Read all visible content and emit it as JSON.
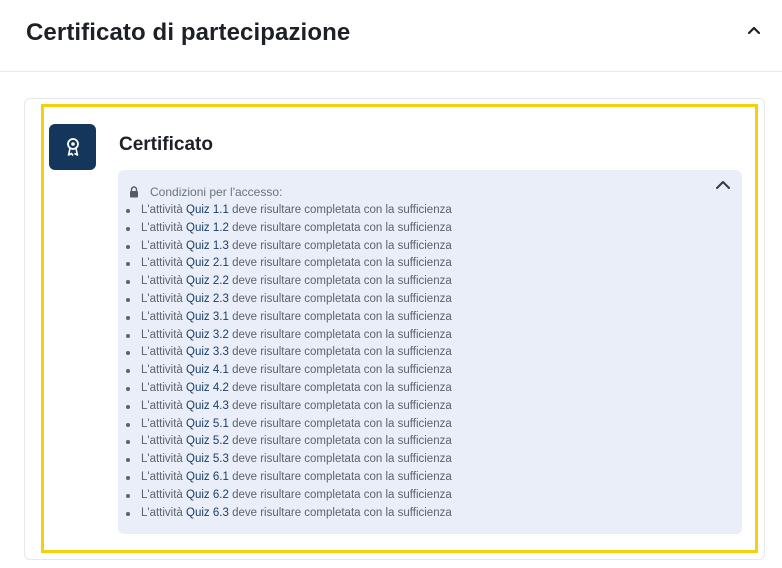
{
  "section": {
    "title": "Certificato di partecipazione"
  },
  "activity": {
    "name": "Certificato",
    "icon": "certificate-icon",
    "icon_bg": "#14365a",
    "highlight_color": "#f6d00b"
  },
  "restrictions": {
    "label": "Condizioni per l'accesso:",
    "bg": "#e9eef8",
    "items": [
      {
        "prefix": "L'attività",
        "quiz": "Quiz 1.1",
        "suffix": "deve risultare completata con la sufficienza"
      },
      {
        "prefix": "L'attività",
        "quiz": "Quiz 1.2",
        "suffix": "deve risultare completata con la sufficienza"
      },
      {
        "prefix": "L'attività",
        "quiz": "Quiz 1.3",
        "suffix": "deve risultare completata con la sufficienza"
      },
      {
        "prefix": "L'attività",
        "quiz": "Quiz 2.1",
        "suffix": "deve risultare completata con la sufficienza"
      },
      {
        "prefix": "L'attività",
        "quiz": "Quiz 2.2",
        "suffix": "deve risultare completata con la sufficienza"
      },
      {
        "prefix": "L'attività",
        "quiz": "Quiz 2.3",
        "suffix": "deve risultare completata con la sufficienza"
      },
      {
        "prefix": "L'attività",
        "quiz": "Quiz 3.1",
        "suffix": "deve risultare completata con la sufficienza"
      },
      {
        "prefix": "L'attività",
        "quiz": "Quiz 3.2",
        "suffix": "deve risultare completata con la sufficienza"
      },
      {
        "prefix": "L'attività",
        "quiz": "Quiz 3.3",
        "suffix": "deve risultare completata con la sufficienza"
      },
      {
        "prefix": "L'attività",
        "quiz": "Quiz 4.1",
        "suffix": "deve risultare completata con la sufficienza"
      },
      {
        "prefix": "L'attività",
        "quiz": "Quiz 4.2",
        "suffix": "deve risultare completata con la sufficienza"
      },
      {
        "prefix": "L'attività",
        "quiz": "Quiz 4.3",
        "suffix": "deve risultare completata con la sufficienza"
      },
      {
        "prefix": "L'attività",
        "quiz": "Quiz 5.1",
        "suffix": "deve risultare completata con la sufficienza"
      },
      {
        "prefix": "L'attività",
        "quiz": "Quiz 5.2",
        "suffix": "deve risultare completata con la sufficienza"
      },
      {
        "prefix": "L'attività",
        "quiz": "Quiz 5.3",
        "suffix": "deve risultare completata con la sufficienza"
      },
      {
        "prefix": "L'attività",
        "quiz": "Quiz 6.1",
        "suffix": "deve risultare completata con la sufficienza"
      },
      {
        "prefix": "L'attività",
        "quiz": "Quiz 6.2",
        "suffix": "deve risultare completata con la sufficienza"
      },
      {
        "prefix": "L'attività",
        "quiz": "Quiz 6.3",
        "suffix": "deve risultare completata con la sufficienza"
      }
    ]
  }
}
